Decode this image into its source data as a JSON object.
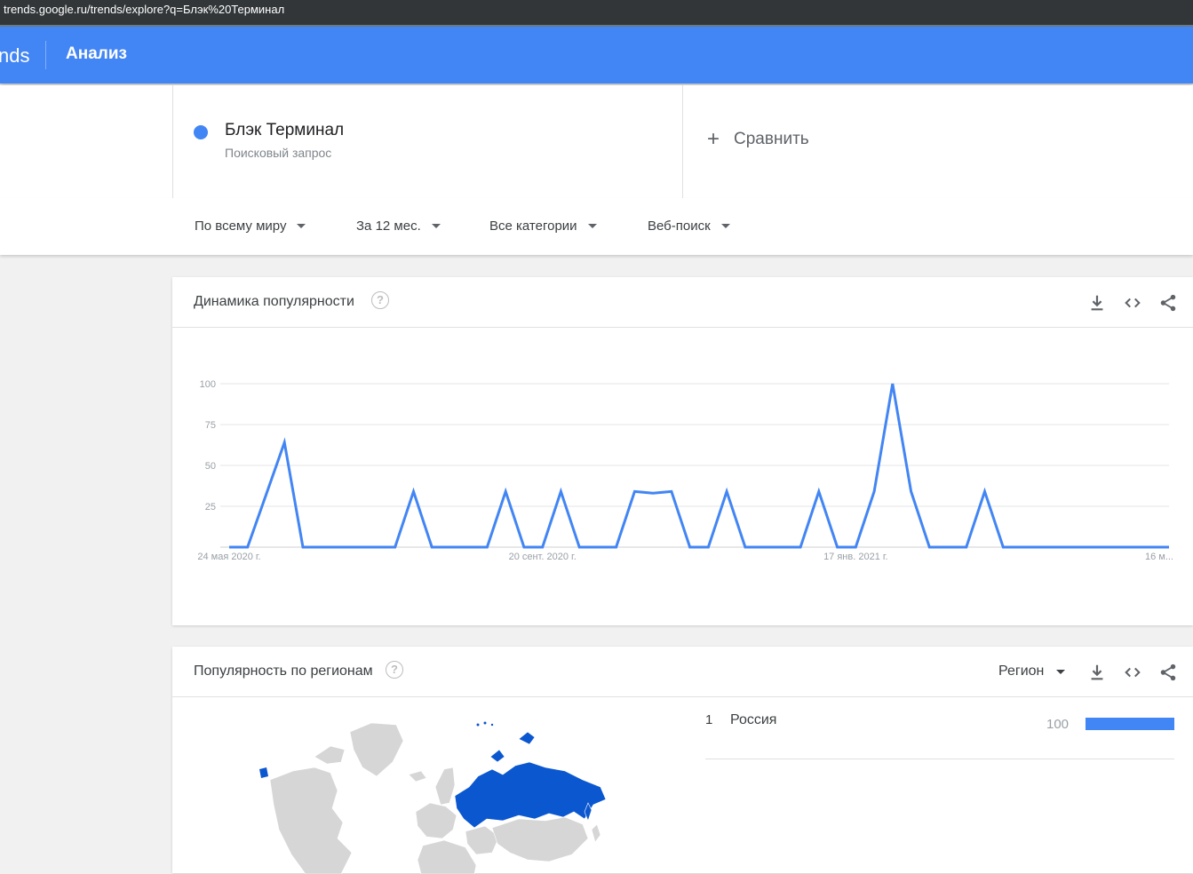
{
  "browser": {
    "url": "trends.google.ru/trends/explore?q=Блэк%20Терминал"
  },
  "header": {
    "logo_fragment": "nds",
    "nav_label": "Анализ"
  },
  "term": {
    "name": "Блэк Терминал",
    "type": "Поисковый запрос",
    "color": "#4285f4"
  },
  "compare": {
    "label": "Сравнить"
  },
  "filters": {
    "region": "По всему миру",
    "period": "За 12 мес.",
    "category": "Все категории",
    "search_type": "Веб-поиск"
  },
  "interest_over_time": {
    "title": "Динамика популярности",
    "help": "?"
  },
  "chart_data": {
    "type": "line",
    "title": "Динамика популярности",
    "xlabel": "",
    "ylabel": "",
    "ylim": [
      0,
      100
    ],
    "yticks": [
      "100",
      "75",
      "50",
      "25"
    ],
    "xtick_labels": [
      "24 мая 2020 г.",
      "20 сент. 2020 г.",
      "17 янв. 2021 г.",
      "16 м..."
    ],
    "xtick_index": [
      0,
      17,
      34,
      51
    ],
    "grid": true,
    "series": [
      {
        "name": "Блэк Терминал",
        "color": "#4285f4",
        "values": [
          0,
          0,
          32,
          64,
          0,
          0,
          0,
          0,
          0,
          0,
          34,
          0,
          0,
          0,
          0,
          34,
          0,
          0,
          34,
          0,
          0,
          0,
          34,
          33,
          34,
          0,
          0,
          34,
          0,
          0,
          0,
          0,
          34,
          0,
          0,
          34,
          100,
          34,
          0,
          0,
          0,
          34,
          0,
          0,
          0,
          0,
          0,
          0,
          0,
          0,
          0,
          0
        ]
      }
    ]
  },
  "interest_by_region": {
    "title": "Популярность по регионам",
    "help": "?",
    "resolution": "Регион",
    "rows": [
      {
        "rank": "1",
        "name": "Россия",
        "value": "100",
        "fraction": 1.0
      }
    ],
    "map_highlight_color": "#0b57d0",
    "map_base_color": "#d6d6d6"
  },
  "icons": [
    "download-icon",
    "embed-icon",
    "share-icon",
    "help-icon",
    "plus-icon",
    "caret-down-icon"
  ]
}
